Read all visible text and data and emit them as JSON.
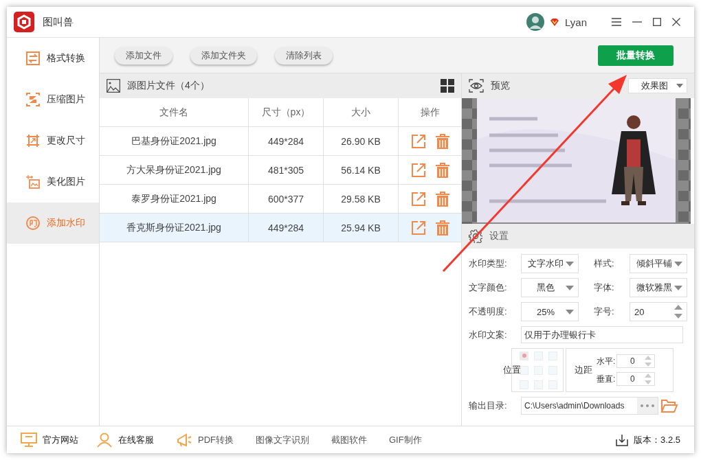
{
  "window": {
    "title": "图叫兽",
    "user": "Lyan"
  },
  "sidebar": {
    "items": [
      {
        "label": "格式转换",
        "selected": false
      },
      {
        "label": "压缩图片",
        "selected": false
      },
      {
        "label": "更改尺寸",
        "selected": false
      },
      {
        "label": "美化图片",
        "selected": false
      },
      {
        "label": "添加水印",
        "selected": true
      }
    ]
  },
  "toolbar": {
    "buttons": [
      "添加文件",
      "添加文件夹",
      "清除列表"
    ],
    "primary": "批量转换"
  },
  "file_list": {
    "title": "源图片文件（4个）",
    "columns": [
      "文件名",
      "尺寸（px）",
      "大小",
      "操作"
    ],
    "rows": [
      {
        "name": "巴基身份证2021.jpg",
        "dimensions": "449*284",
        "size": "26.90 KB",
        "selected": false
      },
      {
        "name": "方大呆身份证2021.jpg",
        "dimensions": "481*305",
        "size": "56.14 KB",
        "selected": false
      },
      {
        "name": "泰罗身份证2021.jpg",
        "dimensions": "600*377",
        "size": "29.58 KB",
        "selected": false
      },
      {
        "name": "香克斯身份证2021.jpg",
        "dimensions": "449*284",
        "size": "25.94 KB",
        "selected": true
      }
    ]
  },
  "preview": {
    "title": "预览",
    "mode": "效果图"
  },
  "settings": {
    "title": "设置",
    "watermark_type": {
      "label": "水印类型:",
      "value": "文字水印"
    },
    "style": {
      "label": "样式:",
      "value": "倾斜平铺"
    },
    "text_color": {
      "label": "文字颜色:",
      "value": "黑色"
    },
    "font": {
      "label": "字体:",
      "value": "微软雅黑"
    },
    "opacity": {
      "label": "不透明度:",
      "value": "25%"
    },
    "font_size": {
      "label": "字号:",
      "value": "20"
    },
    "watermark_text": {
      "label": "水印文案:",
      "value": "仅用于办理银行卡"
    },
    "position": {
      "label": "位置",
      "cells": [
        {
          "selected": true
        },
        {
          "selected": false
        },
        {
          "selected": false
        },
        {
          "selected": false
        },
        {
          "selected": false
        },
        {
          "selected": false
        },
        {
          "selected": false
        },
        {
          "selected": false
        },
        {
          "selected": false
        }
      ]
    },
    "margin": {
      "label": "边距",
      "horizontal": {
        "label": "水平:",
        "value": "0"
      },
      "vertical": {
        "label": "垂直:",
        "value": "0"
      }
    },
    "output": {
      "label": "输出目录:",
      "value": "C:\\Users\\admin\\Downloads"
    }
  },
  "footer": {
    "links": [
      "官方网站",
      "在线客服",
      "PDF转换",
      "图像文字识别",
      "截图软件",
      "GIF制作"
    ],
    "version": "版本：3.2.5"
  }
}
